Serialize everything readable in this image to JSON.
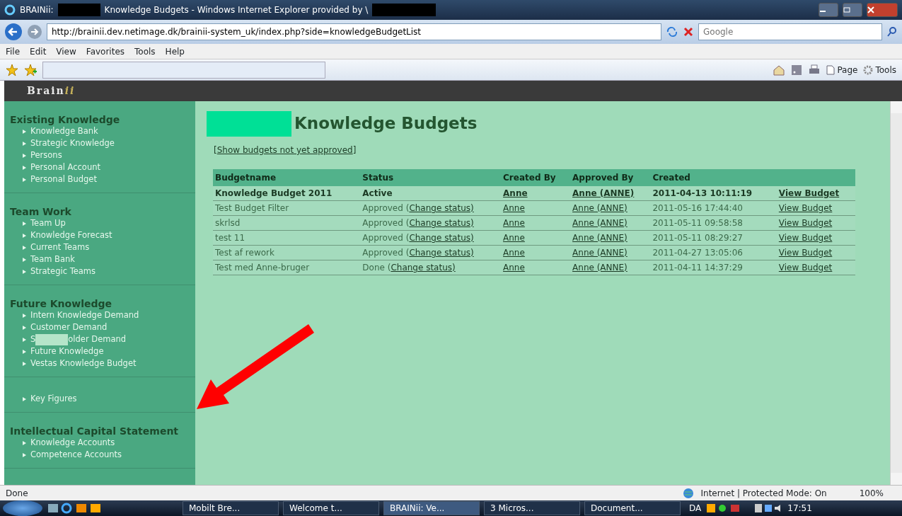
{
  "window": {
    "title_prefix": "BRAINii:",
    "title": "Knowledge Budgets - Windows Internet Explorer provided by \\"
  },
  "address_bar": {
    "url": "http://brainii.dev.netimage.dk/brainii-system_uk/index.php?side=knowledgeBudgetList",
    "search_placeholder": "Google"
  },
  "menu": [
    "File",
    "Edit",
    "View",
    "Favorites",
    "Tools",
    "Help"
  ],
  "command_bar": [
    {
      "label": "Page",
      "kind": "page"
    },
    {
      "label": "Tools",
      "kind": "tools"
    }
  ],
  "app": {
    "logo": "Brain",
    "logo_accent": "ii"
  },
  "sidebar": {
    "sections": [
      {
        "heading": "Existing Knowledge",
        "items": [
          {
            "label": "Knowledge Bank"
          },
          {
            "label": "Strategic Knowledge"
          },
          {
            "label": "Persons"
          },
          {
            "label": "Personal Account"
          },
          {
            "label": "Personal Budget"
          }
        ]
      },
      {
        "heading": "Team Work",
        "items": [
          {
            "label": "Team Up"
          },
          {
            "label": "Knowledge Forecast"
          },
          {
            "label": "Current Teams"
          },
          {
            "label": "Team Bank"
          },
          {
            "label": "Strategic Teams"
          }
        ]
      },
      {
        "heading": "Future Knowledge",
        "items": [
          {
            "label": "Intern Knowledge Demand"
          },
          {
            "label": "Customer Demand"
          },
          {
            "label": "S",
            "label_after": "older Demand"
          },
          {
            "label": "Future Knowledge"
          },
          {
            "label": "Vestas Knowledge Budget"
          }
        ]
      },
      {
        "items": [
          {
            "label": "Key Figures"
          }
        ]
      },
      {
        "heading": "Intellectual Capital Statement",
        "items": [
          {
            "label": "Knowledge Accounts"
          },
          {
            "label": "Competence Accounts"
          }
        ]
      }
    ]
  },
  "page": {
    "title": "Knowledge Budgets",
    "filter_open": "[",
    "filter_link": "Show budgets not yet approved",
    "filter_close": "]"
  },
  "table": {
    "columns": [
      "Budgetname",
      "Status",
      "Created By",
      "Approved By",
      "Created"
    ],
    "rows": [
      {
        "active": true,
        "name": "Knowledge Budget 2011",
        "status": "Active",
        "created_by": "Anne",
        "approved_by": "Anne (ANNE)",
        "created": "2011-04-13 10:11:19",
        "action": "View Budget"
      },
      {
        "active": false,
        "name": "Test Budget Filter",
        "status": "Approved (",
        "status_link": "Change status)",
        "created_by": "Anne",
        "approved_by": "Anne (ANNE)",
        "created": "2011-05-16 17:44:40",
        "action": "View Budget"
      },
      {
        "active": false,
        "name": "skrlsd",
        "status": "Approved (",
        "status_link": "Change status)",
        "created_by": "Anne",
        "approved_by": "Anne (ANNE)",
        "created": "2011-05-11 09:58:58",
        "action": "View Budget"
      },
      {
        "active": false,
        "name": "test 11",
        "status": "Approved (",
        "status_link": "Change status)",
        "created_by": "Anne",
        "approved_by": "Anne (ANNE)",
        "created": "2011-05-11 08:29:27",
        "action": "View Budget"
      },
      {
        "active": false,
        "name": "Test af rework",
        "status": "Approved (",
        "status_link": "Change status)",
        "created_by": "Anne",
        "approved_by": "Anne (ANNE)",
        "created": "2011-04-27 13:05:06",
        "action": "View Budget"
      },
      {
        "active": false,
        "name": "Test med Anne-bruger",
        "status": "Done (",
        "status_link": "Change status)",
        "created_by": "Anne",
        "approved_by": "Anne (ANNE)",
        "created": "2011-04-11 14:37:29",
        "action": "View Budget"
      }
    ]
  },
  "status_bar": {
    "text": "Done",
    "zone": "Internet | Protected Mode: On",
    "zoom": "100%"
  },
  "taskbar": {
    "tasks": [
      {
        "label": "Mobilt Bre...",
        "selected": false
      },
      {
        "label": "Welcome t...",
        "selected": false
      },
      {
        "label": "BRAINii: Ve...",
        "selected": true
      },
      {
        "label": "3 Micros...",
        "selected": false
      },
      {
        "label": "Document...",
        "selected": false
      }
    ],
    "language": "DA",
    "clock": "17:51"
  }
}
